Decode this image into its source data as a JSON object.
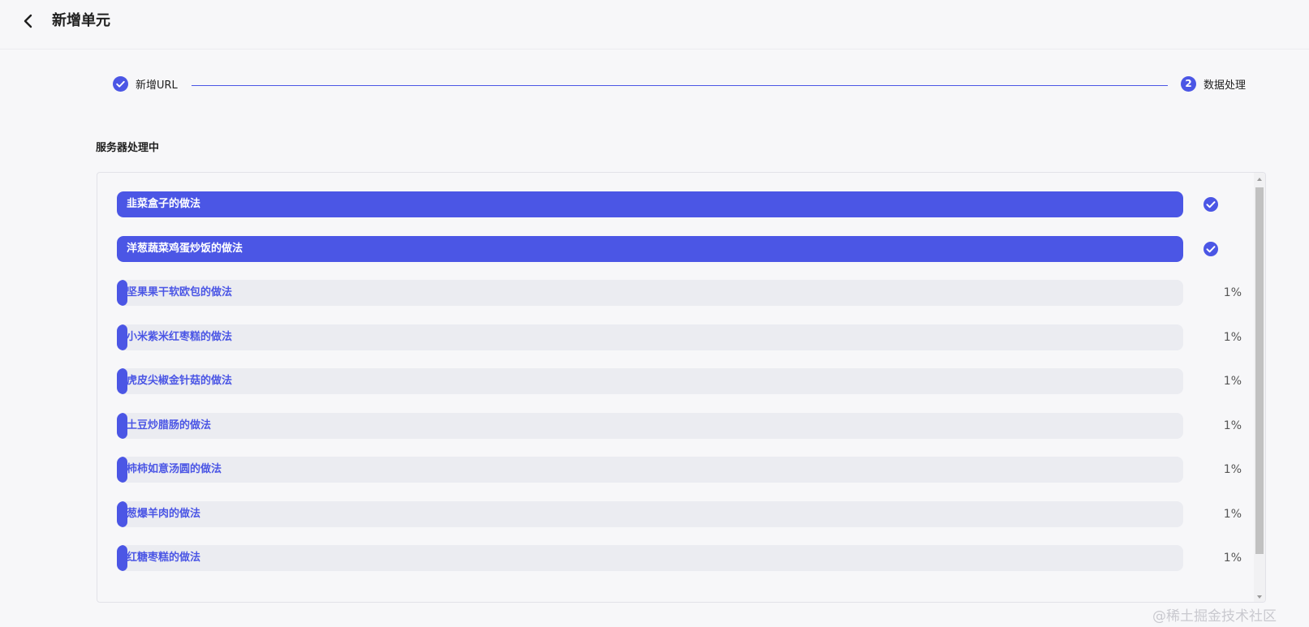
{
  "header": {
    "title": "新增单元",
    "back_icon": "chevron-left-icon"
  },
  "steps": [
    {
      "label": "新增URL",
      "status": "finished",
      "icon": "check-circle-icon"
    },
    {
      "label": "数据处理",
      "status": "active",
      "number": "2"
    }
  ],
  "accent_color": "#4b56e5",
  "section": {
    "title": "服务器处理中"
  },
  "items": [
    {
      "label": "韭菜盒子的做法",
      "progress": 100,
      "done": true,
      "status_icon": "check-circle-icon"
    },
    {
      "label": "洋葱蔬菜鸡蛋炒饭的做法",
      "progress": 100,
      "done": true,
      "status_icon": "check-circle-icon"
    },
    {
      "label": "坚果果干软欧包的做法",
      "progress": 1,
      "done": false,
      "percent_text": "1%"
    },
    {
      "label": "小米紫米红枣糕的做法",
      "progress": 1,
      "done": false,
      "percent_text": "1%"
    },
    {
      "label": "虎皮尖椒金针菇的做法",
      "progress": 1,
      "done": false,
      "percent_text": "1%"
    },
    {
      "label": "土豆炒腊肠的做法",
      "progress": 1,
      "done": false,
      "percent_text": "1%"
    },
    {
      "label": "柿柿如意汤圆的做法",
      "progress": 1,
      "done": false,
      "percent_text": "1%"
    },
    {
      "label": "葱爆羊肉的做法",
      "progress": 1,
      "done": false,
      "percent_text": "1%"
    },
    {
      "label": "红糖枣糕的做法",
      "progress": 1,
      "done": false,
      "percent_text": "1%"
    }
  ],
  "watermark": "@稀土掘金技术社区"
}
